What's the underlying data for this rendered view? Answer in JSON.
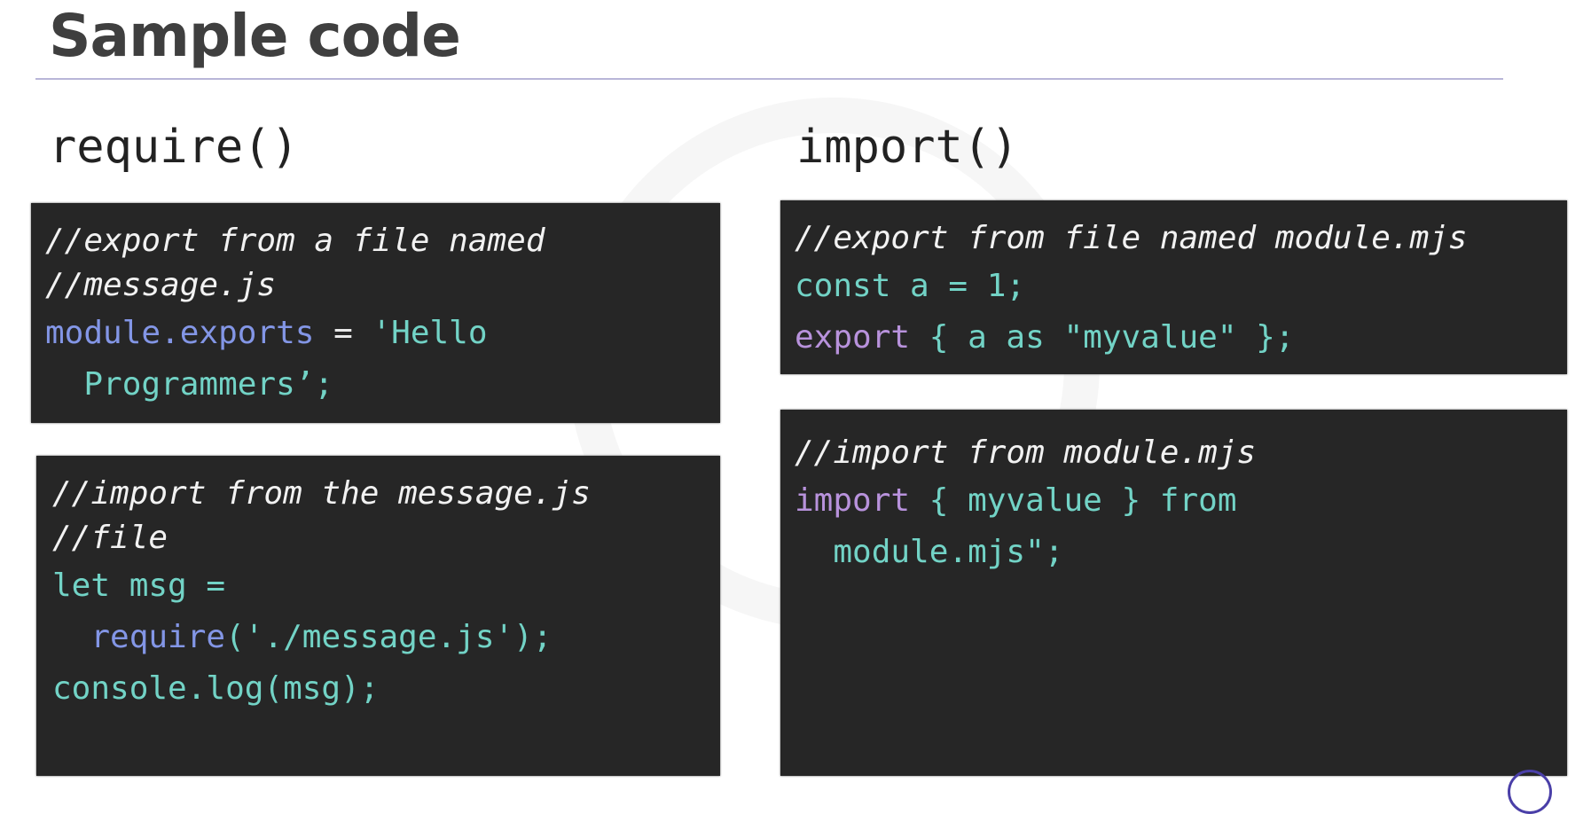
{
  "title": "Sample code",
  "left": {
    "heading": "require()",
    "export_box": {
      "comments": [
        "//export from a file named",
        "//message.js"
      ],
      "line1": {
        "a": "module.exports",
        "b": " = ",
        "c": "'Hello"
      },
      "line2": "  Programmers’;"
    },
    "import_box": {
      "comments": [
        "//import from the message.js",
        "//file"
      ],
      "line1": "let msg =",
      "line2": {
        "indent": "  ",
        "a": "require",
        "b": "('./message.js');"
      },
      "line3": "console.log(msg);"
    }
  },
  "right": {
    "heading": "import()",
    "export_box": {
      "comments": [
        "//export from file named module.mjs"
      ],
      "line1": "const a = 1;",
      "line2": {
        "a": "export",
        "b": " { a as \"myvalue\" };"
      }
    },
    "import_box": {
      "comments": [
        "//import from module.mjs"
      ],
      "line1": {
        "a": "import",
        "b": " { myvalue } from"
      },
      "line2": "  module.mjs\";"
    }
  },
  "colors": {
    "code_bg": "#262626",
    "keyword_blue": "#8396e6",
    "string_teal": "#72d3c6",
    "keyword_purple": "#b892dc"
  }
}
